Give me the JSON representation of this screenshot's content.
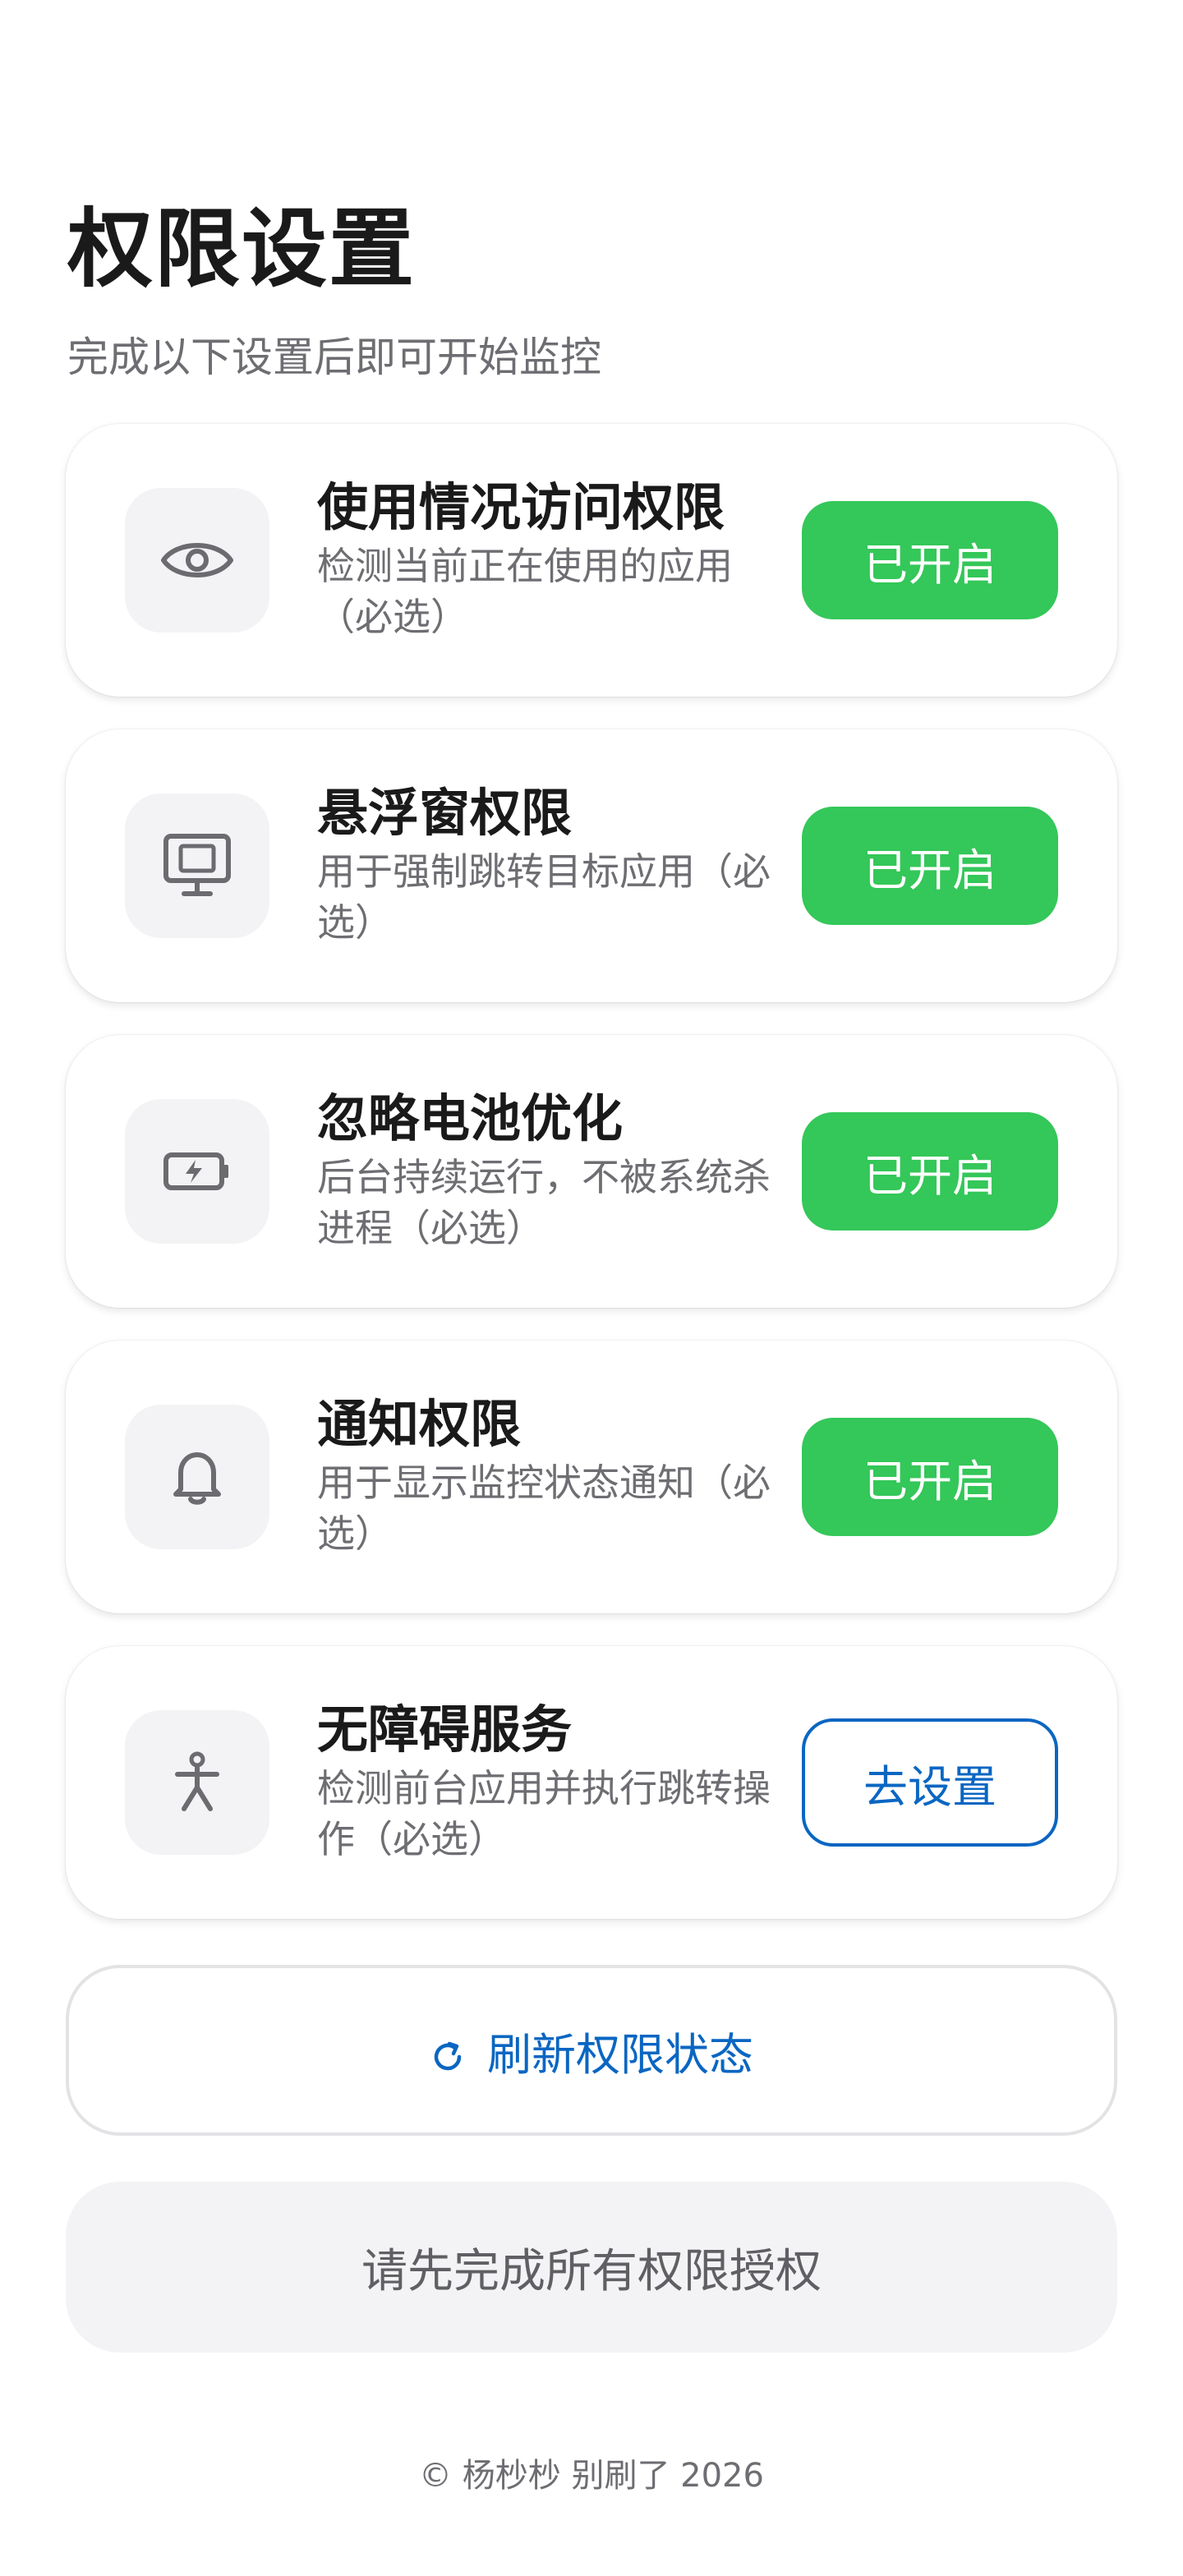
{
  "header": {
    "title": "权限设置",
    "subtitle": "完成以下设置后即可开始监控"
  },
  "permissions": [
    {
      "icon": "eye-icon",
      "title": "使用情况访问权限",
      "description": "检测当前正在使用的应用（必选）",
      "button_label": "已开启",
      "status": "granted"
    },
    {
      "icon": "monitor-icon",
      "title": "悬浮窗权限",
      "description": "用于强制跳转目标应用（必选）",
      "button_label": "已开启",
      "status": "granted"
    },
    {
      "icon": "battery-icon",
      "title": "忽略电池优化",
      "description": "后台持续运行，不被系统杀进程（必选）",
      "button_label": "已开启",
      "status": "granted"
    },
    {
      "icon": "bell-icon",
      "title": "通知权限",
      "description": "用于显示监控状态通知（必选）",
      "button_label": "已开启",
      "status": "granted"
    },
    {
      "icon": "accessibility-icon",
      "title": "无障碍服务",
      "description": "检测前台应用并执行跳转操作（必选）",
      "button_label": "去设置",
      "status": "not-granted"
    }
  ],
  "actions": {
    "refresh_icon": "refresh-icon",
    "refresh_label": "刷新权限状态",
    "submit_label": "请先完成所有权限授权"
  },
  "footer": {
    "text": "© 杨杪杪 别刷了 2026"
  },
  "colors": {
    "granted": "#34c759",
    "link": "#0a66c2",
    "muted": "#6d6d72"
  }
}
